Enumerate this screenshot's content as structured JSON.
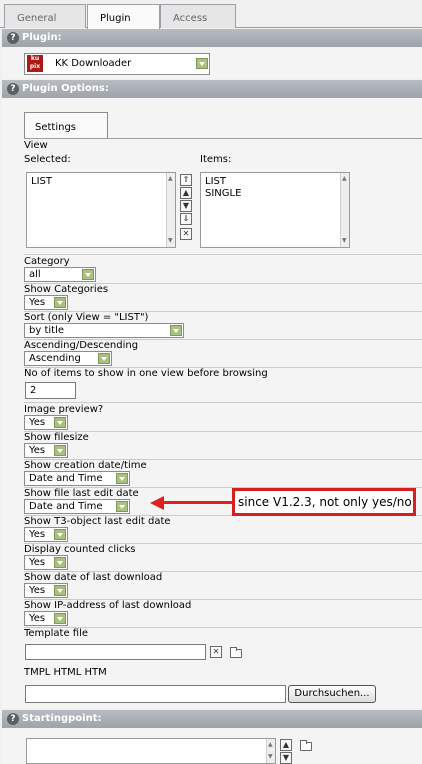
{
  "tabs": [
    "General",
    "Plugin",
    "Access"
  ],
  "sections": {
    "plugin": "Plugin:",
    "plugin_options": "Plugin Options:",
    "starting_point": "Startingpoint:"
  },
  "plugin_select": {
    "icon_text_top": "ku",
    "icon_text_bottom": "pix",
    "value": "KK Downloader"
  },
  "settings_tab": "Settings",
  "view": {
    "label": "View",
    "selected_label": "Selected:",
    "items_label": "Items:",
    "selected": [
      "LIST"
    ],
    "items": [
      "LIST",
      "SINGLE"
    ]
  },
  "fields": {
    "category": {
      "label": "Category",
      "value": "all"
    },
    "show_categories": {
      "label": "Show Categories",
      "value": "Yes"
    },
    "sort": {
      "label": "Sort (only View = \"LIST\")",
      "value": "by title"
    },
    "asc_desc": {
      "label": "Ascending/Descending",
      "value": "Ascending"
    },
    "items_per_view": {
      "label": "No of items to show in one view before browsing",
      "value": "2"
    },
    "image_preview": {
      "label": "Image preview?",
      "value": "Yes"
    },
    "show_filesize": {
      "label": "Show filesize",
      "value": "Yes"
    },
    "show_creation": {
      "label": "Show creation date/time",
      "value": "Date and Time"
    },
    "show_last_edit": {
      "label": "Show file last edit date",
      "value": "Date and Time"
    },
    "show_t3_edit": {
      "label": "Show T3-object last edit date",
      "value": "Yes"
    },
    "display_clicks": {
      "label": "Display counted clicks",
      "value": "Yes"
    },
    "show_last_download": {
      "label": "Show date of last download",
      "value": "Yes"
    },
    "show_ip": {
      "label": "Show IP-address of last download",
      "value": "Yes"
    },
    "template_file": {
      "label": "Template file",
      "value": ""
    },
    "tmpl_types": {
      "label": "TMPL HTML HTM"
    }
  },
  "browse_button": "Durchsuchen...",
  "callout": "since V1.2.3, not only yes/no",
  "colors": {
    "callout_border": "#d62020",
    "section_header": "#9da3aa",
    "select_button": "#a8c080"
  }
}
